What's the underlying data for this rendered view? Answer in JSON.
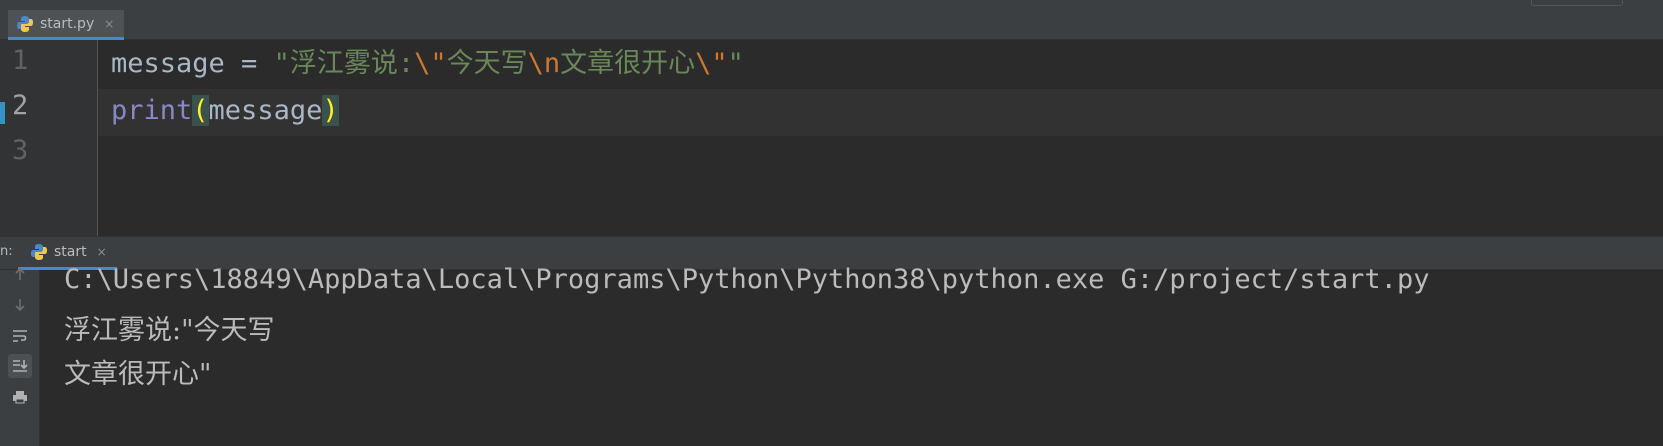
{
  "editor_tab": {
    "label": "start.py",
    "close": "×"
  },
  "editor": {
    "line_numbers": [
      "1",
      "2",
      "3"
    ],
    "line1": {
      "var": "message",
      "op": " = ",
      "str_open": "\"浮江雾说:",
      "esc1": "\\\"",
      "str_mid": "今天写",
      "esc2": "\\n",
      "str_mid2": "文章很开心",
      "esc3": "\\\"",
      "str_close": "\""
    },
    "line2": {
      "builtin": "print",
      "lparen": "(",
      "arg": "message",
      "rparen": ")"
    }
  },
  "run_panel": {
    "prefix": "n:",
    "tab_label": "start",
    "close": "×"
  },
  "console": {
    "lines": [
      "C:\\Users\\18849\\AppData\\Local\\Programs\\Python\\Python38\\python.exe G:/project/start.py",
      "浮江雾说:\"今天写",
      "文章很开心\""
    ]
  },
  "toolbar_icons": [
    "arrow-up-icon",
    "arrow-down-icon",
    "soft-wrap-icon",
    "scroll-to-end-icon",
    "print-icon"
  ],
  "colors": {
    "background": "#2b2b2b",
    "string": "#6a8759",
    "escape": "#cc7832",
    "builtin": "#8888c6",
    "paren_match": "#ffef28",
    "accent": "#4a88c7"
  }
}
